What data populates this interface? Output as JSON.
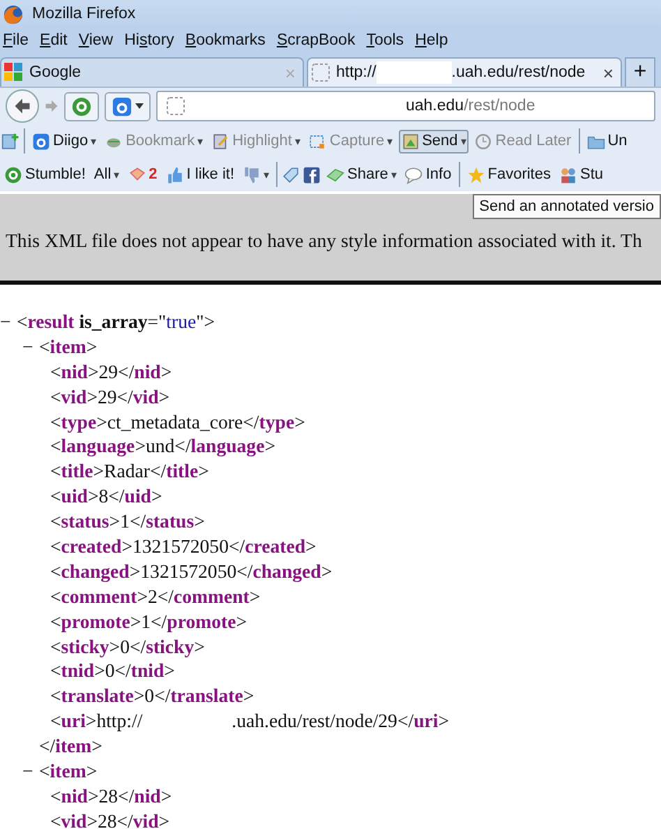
{
  "window": {
    "title": "Mozilla Firefox"
  },
  "menu": [
    {
      "key": "F",
      "after": "ile"
    },
    {
      "key": "E",
      "after": "dit"
    },
    {
      "key": "V",
      "after": "iew"
    },
    {
      "before": "Hi",
      "key": "s",
      "after": "tory"
    },
    {
      "key": "B",
      "after": "ookmarks"
    },
    {
      "key": "S",
      "after": "crapBook"
    },
    {
      "key": "T",
      "after": "ools"
    },
    {
      "key": "H",
      "after": "elp"
    }
  ],
  "tabs": [
    {
      "title": [
        {
          "kind": "text",
          "text": "Google"
        }
      ],
      "close": "×",
      "selected": false
    },
    {
      "title": [
        {
          "kind": "text",
          "text": "http://"
        },
        {
          "kind": "blank"
        },
        {
          "kind": "text",
          "text": ".uah.edu/rest/node"
        }
      ],
      "close": "×",
      "selected": true
    }
  ],
  "new_tab": "+",
  "address": {
    "host": "uah.edu",
    "path": "/rest/node"
  },
  "toolbar1": [
    {
      "kind": "diigo",
      "label": "Diigo",
      "dropdown": "▾",
      "disabled": false,
      "pressed": false
    },
    {
      "kind": "bookmark",
      "label": "Bookmark",
      "dropdown": "▾",
      "disabled": true,
      "pressed": false
    },
    {
      "kind": "highlight",
      "label": "Highlight",
      "dropdown": "▾",
      "disabled": true,
      "pressed": false
    },
    {
      "kind": "capture",
      "label": "Capture",
      "dropdown": "▾",
      "disabled": true,
      "pressed": false
    },
    {
      "kind": "send",
      "label": "Send",
      "dropdown": "▾",
      "disabled": false,
      "pressed": true
    },
    {
      "kind": "readlater",
      "label": "Read Later",
      "disabled": true,
      "pressed": false
    },
    {
      "kind": "folder",
      "label": "Un",
      "disabled": false,
      "pressed": false
    }
  ],
  "toolbar2": {
    "stumble": "Stumble!",
    "all": "All",
    "all_dropdown": "▾",
    "count": "2",
    "like": "I like it!",
    "dislike_dropdown": "▾",
    "share": "Share",
    "share_dropdown": "▾",
    "info": "Info",
    "favorites": "Favorites",
    "stumblers": "Stu"
  },
  "tooltip": "Send an annotated versio",
  "xml_notice": "This XML file does not appear to have any style information associated with it. Th",
  "xml": {
    "toggle": "−",
    "open": [
      {
        "kind": "punct",
        "text": "<"
      },
      {
        "kind": "tag",
        "text": "result"
      },
      {
        "kind": "attr",
        "text": " is_array"
      },
      {
        "kind": "punct",
        "text": "=\""
      },
      {
        "kind": "value",
        "text": "true"
      },
      {
        "kind": "punct",
        "text": "\">"
      }
    ],
    "children": [
      {
        "toggle": "−",
        "open": [
          {
            "kind": "punct",
            "text": "<"
          },
          {
            "kind": "tag",
            "text": "item"
          },
          {
            "kind": "punct",
            "text": ">"
          }
        ],
        "children": [
          {
            "line": [
              {
                "kind": "punct",
                "text": "<"
              },
              {
                "kind": "tag",
                "text": "nid"
              },
              {
                "kind": "punct",
                "text": ">"
              },
              {
                "kind": "text",
                "text": "29"
              },
              {
                "kind": "punct",
                "text": "</"
              },
              {
                "kind": "tag",
                "text": "nid"
              },
              {
                "kind": "punct",
                "text": ">"
              }
            ]
          },
          {
            "line": [
              {
                "kind": "punct",
                "text": "<"
              },
              {
                "kind": "tag",
                "text": "vid"
              },
              {
                "kind": "punct",
                "text": ">"
              },
              {
                "kind": "text",
                "text": "29"
              },
              {
                "kind": "punct",
                "text": "</"
              },
              {
                "kind": "tag",
                "text": "vid"
              },
              {
                "kind": "punct",
                "text": ">"
              }
            ]
          },
          {
            "line": [
              {
                "kind": "punct",
                "text": "<"
              },
              {
                "kind": "tag",
                "text": "type"
              },
              {
                "kind": "punct",
                "text": ">"
              },
              {
                "kind": "text",
                "text": "ct_metadata_core"
              },
              {
                "kind": "punct",
                "text": "</"
              },
              {
                "kind": "tag",
                "text": "type"
              },
              {
                "kind": "punct",
                "text": ">"
              }
            ]
          },
          {
            "line": [
              {
                "kind": "punct",
                "text": "<"
              },
              {
                "kind": "tag",
                "text": "language"
              },
              {
                "kind": "punct",
                "text": ">"
              },
              {
                "kind": "text",
                "text": "und"
              },
              {
                "kind": "punct",
                "text": "</"
              },
              {
                "kind": "tag",
                "text": "language"
              },
              {
                "kind": "punct",
                "text": ">"
              }
            ]
          },
          {
            "line": [
              {
                "kind": "punct",
                "text": "<"
              },
              {
                "kind": "tag",
                "text": "title"
              },
              {
                "kind": "punct",
                "text": ">"
              },
              {
                "kind": "text",
                "text": "Radar"
              },
              {
                "kind": "punct",
                "text": "</"
              },
              {
                "kind": "tag",
                "text": "title"
              },
              {
                "kind": "punct",
                "text": ">"
              }
            ]
          },
          {
            "line": [
              {
                "kind": "punct",
                "text": "<"
              },
              {
                "kind": "tag",
                "text": "uid"
              },
              {
                "kind": "punct",
                "text": ">"
              },
              {
                "kind": "text",
                "text": "8"
              },
              {
                "kind": "punct",
                "text": "</"
              },
              {
                "kind": "tag",
                "text": "uid"
              },
              {
                "kind": "punct",
                "text": ">"
              }
            ]
          },
          {
            "line": [
              {
                "kind": "punct",
                "text": "<"
              },
              {
                "kind": "tag",
                "text": "status"
              },
              {
                "kind": "punct",
                "text": ">"
              },
              {
                "kind": "text",
                "text": "1"
              },
              {
                "kind": "punct",
                "text": "</"
              },
              {
                "kind": "tag",
                "text": "status"
              },
              {
                "kind": "punct",
                "text": ">"
              }
            ]
          },
          {
            "line": [
              {
                "kind": "punct",
                "text": "<"
              },
              {
                "kind": "tag",
                "text": "created"
              },
              {
                "kind": "punct",
                "text": ">"
              },
              {
                "kind": "text",
                "text": "1321572050"
              },
              {
                "kind": "punct",
                "text": "</"
              },
              {
                "kind": "tag",
                "text": "created"
              },
              {
                "kind": "punct",
                "text": ">"
              }
            ]
          },
          {
            "line": [
              {
                "kind": "punct",
                "text": "<"
              },
              {
                "kind": "tag",
                "text": "changed"
              },
              {
                "kind": "punct",
                "text": ">"
              },
              {
                "kind": "text",
                "text": "1321572050"
              },
              {
                "kind": "punct",
                "text": "</"
              },
              {
                "kind": "tag",
                "text": "changed"
              },
              {
                "kind": "punct",
                "text": ">"
              }
            ]
          },
          {
            "line": [
              {
                "kind": "punct",
                "text": "<"
              },
              {
                "kind": "tag",
                "text": "comment"
              },
              {
                "kind": "punct",
                "text": ">"
              },
              {
                "kind": "text",
                "text": "2"
              },
              {
                "kind": "punct",
                "text": "</"
              },
              {
                "kind": "tag",
                "text": "comment"
              },
              {
                "kind": "punct",
                "text": ">"
              }
            ]
          },
          {
            "line": [
              {
                "kind": "punct",
                "text": "<"
              },
              {
                "kind": "tag",
                "text": "promote"
              },
              {
                "kind": "punct",
                "text": ">"
              },
              {
                "kind": "text",
                "text": "1"
              },
              {
                "kind": "punct",
                "text": "</"
              },
              {
                "kind": "tag",
                "text": "promote"
              },
              {
                "kind": "punct",
                "text": ">"
              }
            ]
          },
          {
            "line": [
              {
                "kind": "punct",
                "text": "<"
              },
              {
                "kind": "tag",
                "text": "sticky"
              },
              {
                "kind": "punct",
                "text": ">"
              },
              {
                "kind": "text",
                "text": "0"
              },
              {
                "kind": "punct",
                "text": "</"
              },
              {
                "kind": "tag",
                "text": "sticky"
              },
              {
                "kind": "punct",
                "text": ">"
              }
            ]
          },
          {
            "line": [
              {
                "kind": "punct",
                "text": "<"
              },
              {
                "kind": "tag",
                "text": "tnid"
              },
              {
                "kind": "punct",
                "text": ">"
              },
              {
                "kind": "text",
                "text": "0"
              },
              {
                "kind": "punct",
                "text": "</"
              },
              {
                "kind": "tag",
                "text": "tnid"
              },
              {
                "kind": "punct",
                "text": ">"
              }
            ]
          },
          {
            "line": [
              {
                "kind": "punct",
                "text": "<"
              },
              {
                "kind": "tag",
                "text": "translate"
              },
              {
                "kind": "punct",
                "text": ">"
              },
              {
                "kind": "text",
                "text": "0"
              },
              {
                "kind": "punct",
                "text": "</"
              },
              {
                "kind": "tag",
                "text": "translate"
              },
              {
                "kind": "punct",
                "text": ">"
              }
            ]
          },
          {
            "line": [
              {
                "kind": "punct",
                "text": "<"
              },
              {
                "kind": "tag",
                "text": "uri"
              },
              {
                "kind": "punct",
                "text": ">"
              },
              {
                "kind": "text",
                "text": "http://"
              },
              {
                "kind": "blank"
              },
              {
                "kind": "text",
                "text": ".uah.edu/rest/node/29"
              },
              {
                "kind": "punct",
                "text": "</"
              },
              {
                "kind": "tag",
                "text": "uri"
              },
              {
                "kind": "punct",
                "text": ">"
              }
            ]
          }
        ],
        "close": [
          {
            "kind": "punct",
            "text": "</"
          },
          {
            "kind": "tag",
            "text": "item"
          },
          {
            "kind": "punct",
            "text": ">"
          }
        ]
      },
      {
        "toggle": "−",
        "open": [
          {
            "kind": "punct",
            "text": "<"
          },
          {
            "kind": "tag",
            "text": "item"
          },
          {
            "kind": "punct",
            "text": ">"
          }
        ],
        "children": [
          {
            "line": [
              {
                "kind": "punct",
                "text": "<"
              },
              {
                "kind": "tag",
                "text": "nid"
              },
              {
                "kind": "punct",
                "text": ">"
              },
              {
                "kind": "text",
                "text": "28"
              },
              {
                "kind": "punct",
                "text": "</"
              },
              {
                "kind": "tag",
                "text": "nid"
              },
              {
                "kind": "punct",
                "text": ">"
              }
            ]
          },
          {
            "line": [
              {
                "kind": "punct",
                "text": "<"
              },
              {
                "kind": "tag",
                "text": "vid"
              },
              {
                "kind": "punct",
                "text": ">"
              },
              {
                "kind": "text",
                "text": "28"
              },
              {
                "kind": "punct",
                "text": "</"
              },
              {
                "kind": "tag",
                "text": "vid"
              },
              {
                "kind": "punct",
                "text": ">"
              }
            ]
          }
        ]
      }
    ]
  }
}
